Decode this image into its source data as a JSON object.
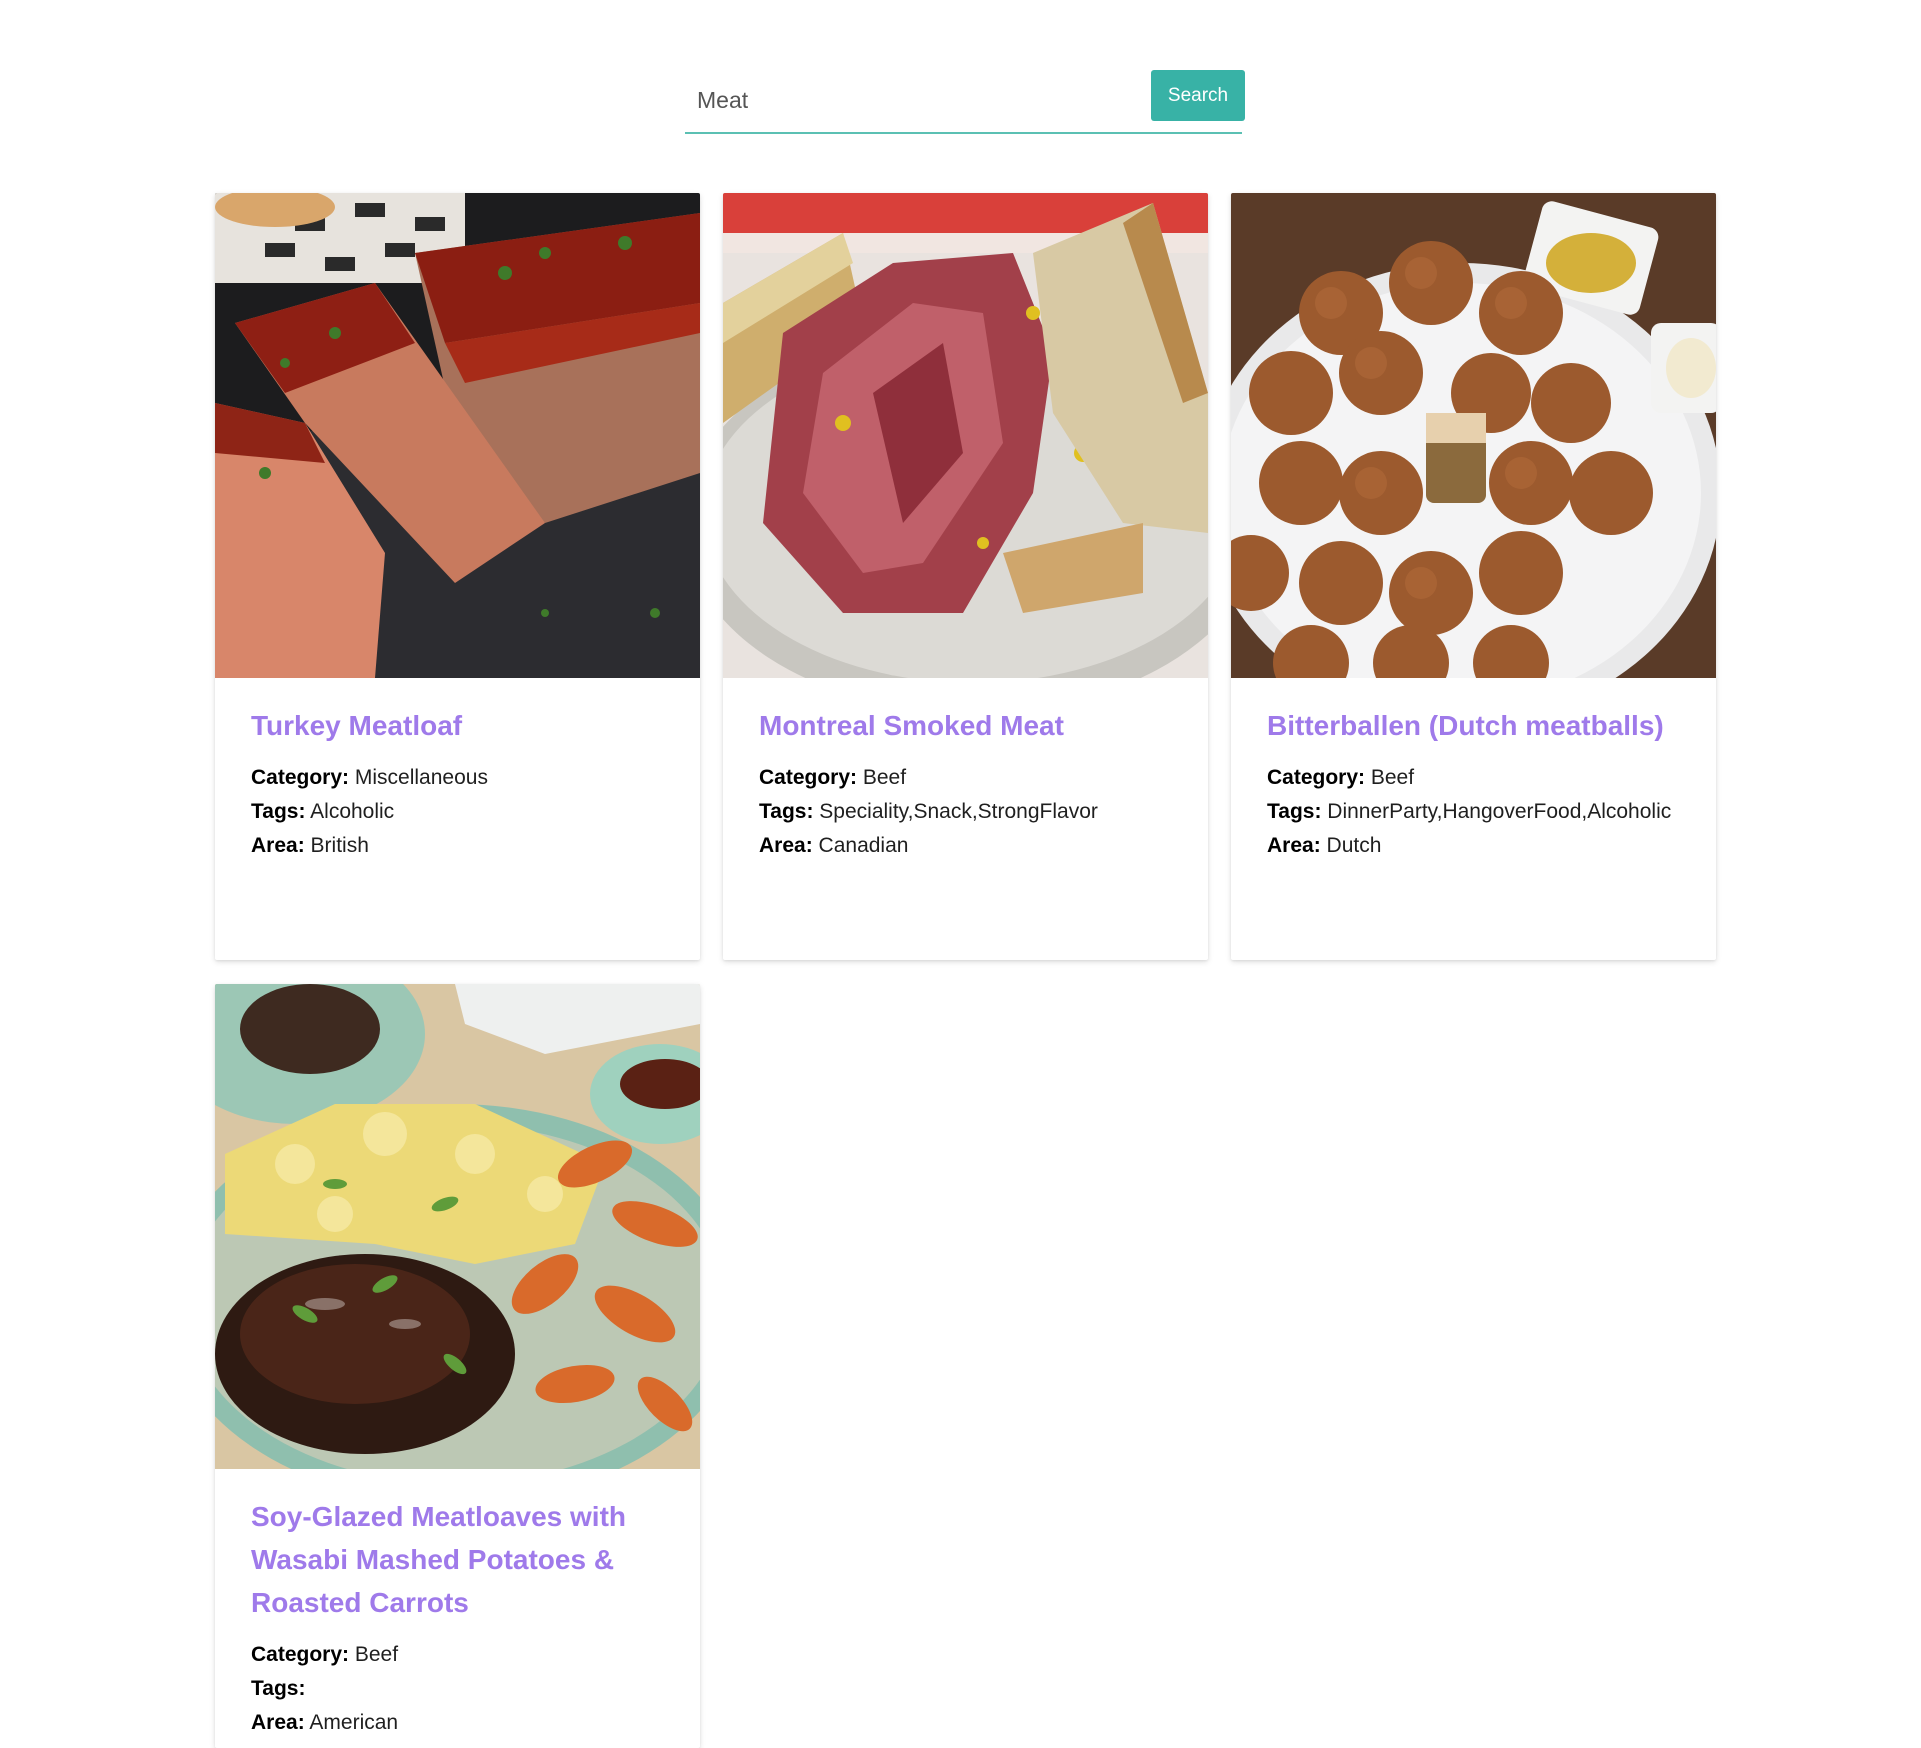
{
  "search": {
    "value": "Meat",
    "button_label": "Search"
  },
  "colors": {
    "accent": "#38b2a6",
    "title": "#9f7aea"
  },
  "labels": {
    "category": "Category:",
    "tags": "Tags:",
    "area": "Area:"
  },
  "meals": [
    {
      "title": "Turkey Meatloaf",
      "category": "Miscellaneous",
      "tags": "Alcoholic",
      "area": "British",
      "image_icon": "meatloaf-photo"
    },
    {
      "title": "Montreal Smoked Meat",
      "category": "Beef",
      "tags": "Speciality,Snack,StrongFlavor",
      "area": "Canadian",
      "image_icon": "smoked-meat-sandwich-photo"
    },
    {
      "title": "Bitterballen (Dutch meatballs)",
      "category": "Beef",
      "tags": "DinnerParty,HangoverFood,Alcoholic",
      "area": "Dutch",
      "image_icon": "fried-meatballs-photo"
    },
    {
      "title": "Soy-Glazed Meatloaves with Wasabi Mashed Potatoes & Roasted Carrots",
      "category": "Beef",
      "tags": "",
      "area": "American",
      "image_icon": "glazed-meatloaf-plate-photo"
    }
  ]
}
